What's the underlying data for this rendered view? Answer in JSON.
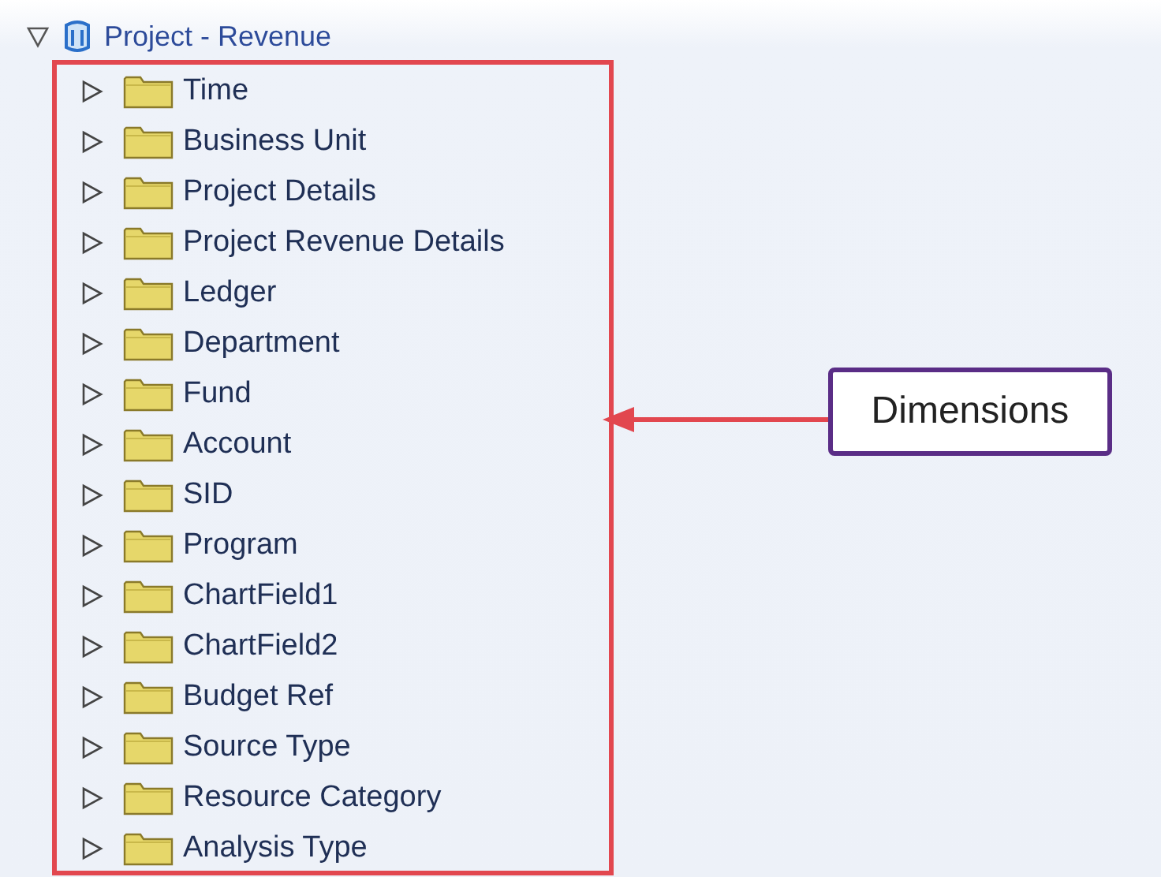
{
  "tree": {
    "label": "Project - Revenue",
    "expanded": true,
    "children": [
      {
        "label": "Time",
        "expanded": false
      },
      {
        "label": "Business Unit",
        "expanded": false
      },
      {
        "label": "Project Details",
        "expanded": false
      },
      {
        "label": "Project Revenue Details",
        "expanded": false
      },
      {
        "label": "Ledger",
        "expanded": false
      },
      {
        "label": "Department",
        "expanded": false
      },
      {
        "label": "Fund",
        "expanded": false
      },
      {
        "label": "Account",
        "expanded": false
      },
      {
        "label": "SID",
        "expanded": false
      },
      {
        "label": "Program",
        "expanded": false
      },
      {
        "label": "ChartField1",
        "expanded": false
      },
      {
        "label": "ChartField2",
        "expanded": false
      },
      {
        "label": "Budget Ref",
        "expanded": false
      },
      {
        "label": "Source Type",
        "expanded": false
      },
      {
        "label": "Resource Category",
        "expanded": false
      },
      {
        "label": "Analysis Type",
        "expanded": false
      }
    ]
  },
  "callout": {
    "text": "Dimensions"
  }
}
